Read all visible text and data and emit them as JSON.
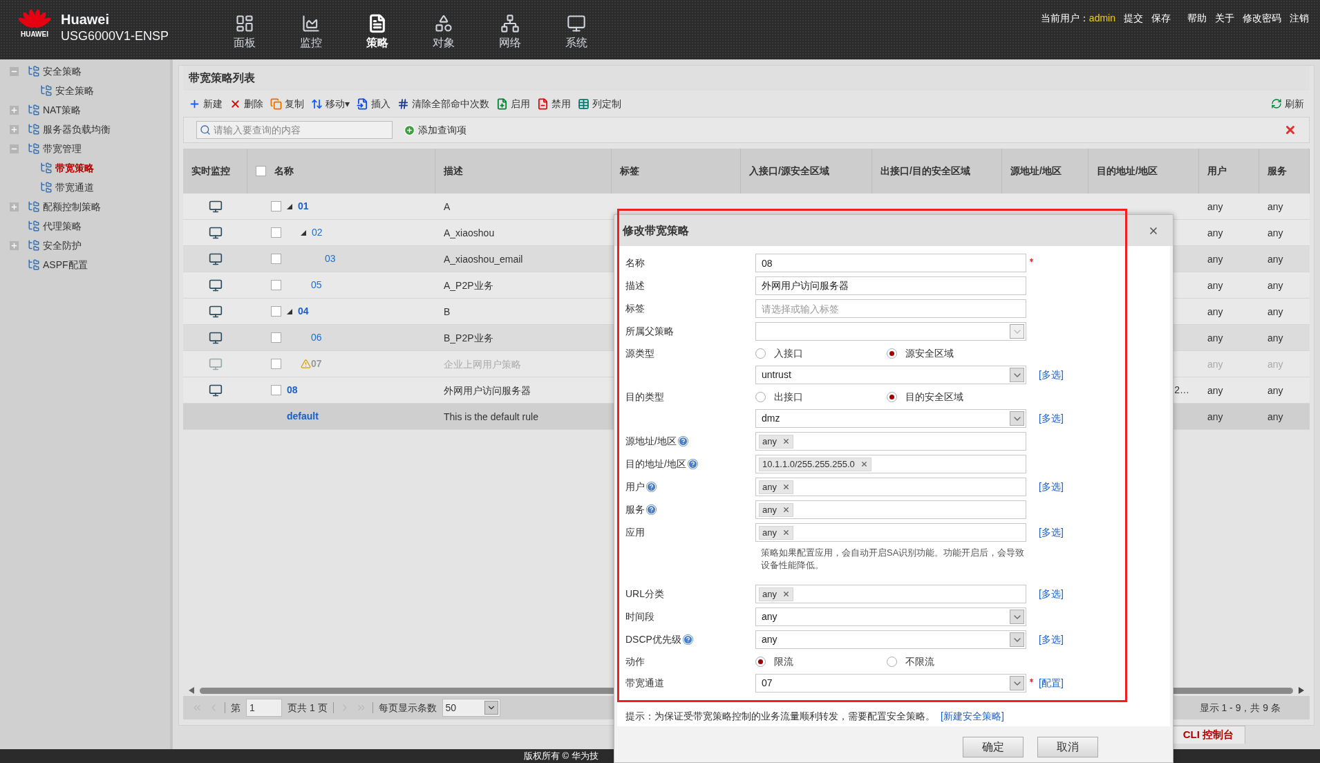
{
  "header": {
    "logo_text": "HUAWEI",
    "brand": "Huawei",
    "model": "USG6000V1-ENSP",
    "nav": [
      {
        "label": "面板",
        "selected": false
      },
      {
        "label": "监控",
        "selected": false
      },
      {
        "label": "策略",
        "selected": true
      },
      {
        "label": "对象",
        "selected": false
      },
      {
        "label": "网络",
        "selected": false
      },
      {
        "label": "系统",
        "selected": false
      }
    ],
    "user_label": "当前用户：",
    "user": "admin",
    "links": [
      "提交",
      "保存",
      "帮助",
      "关于",
      "修改密码",
      "注销"
    ]
  },
  "sidebar": {
    "items": [
      {
        "label": "安全策略",
        "expanded": true,
        "selected": false,
        "children": [
          {
            "label": "安全策略",
            "selected": false
          }
        ]
      },
      {
        "label": "NAT策略",
        "expanded": false,
        "selected": false
      },
      {
        "label": "服务器负载均衡",
        "expanded": false,
        "selected": false
      },
      {
        "label": "带宽管理",
        "expanded": true,
        "selected": false,
        "children": [
          {
            "label": "带宽策略",
            "selected": true
          },
          {
            "label": "带宽通道",
            "selected": false
          }
        ]
      },
      {
        "label": "配额控制策略",
        "expanded": false,
        "selected": false
      },
      {
        "label": "代理策略",
        "selected": false
      },
      {
        "label": "安全防护",
        "expanded": false,
        "selected": false
      },
      {
        "label": "ASPF配置",
        "selected": false
      }
    ]
  },
  "panel": {
    "title": "带宽策略列表",
    "toolbar": [
      "新建",
      "删除",
      "复制",
      "移动▾",
      "插入",
      "清除全部命中次数",
      "启用",
      "禁用",
      "列定制"
    ],
    "refresh": "刷新",
    "search": {
      "placeholder": "请输入要查询的内容"
    },
    "add_query": "添加查询项"
  },
  "table": {
    "columns": [
      "实时监控",
      "名称",
      "描述",
      "标签",
      "入接口/源安全区域",
      "出接口/目的安全区域",
      "源地址/地区",
      "目的地址/地区",
      "用户",
      "服务"
    ],
    "select_all_checked": false,
    "rows": [
      {
        "name": "01",
        "description": "A",
        "expanded": true,
        "checked": false,
        "disabled": false,
        "user": "any",
        "service": "any",
        "children": [
          {
            "name": "02",
            "description": "A_xiaoshou",
            "expanded": true,
            "checked": false,
            "disabled": false,
            "user": "any",
            "service": "any",
            "children": [
              {
                "name": "03",
                "description": "A_xiaoshou_email",
                "checked": false,
                "disabled": false,
                "user": "any",
                "service": "any"
              }
            ]
          },
          {
            "name": "05",
            "description": "A_P2P业务",
            "checked": false,
            "disabled": false,
            "user": "any",
            "service": "any"
          }
        ]
      },
      {
        "name": "04",
        "description": "B",
        "expanded": true,
        "checked": false,
        "disabled": false,
        "user": "any",
        "service": "any",
        "children": [
          {
            "name": "06",
            "description": "B_P2P业务",
            "checked": false,
            "disabled": false,
            "user": "any",
            "service": "any"
          },
          {
            "name": "07",
            "description": "企业上网用户策略",
            "checked": false,
            "disabled": true,
            "user": "any",
            "service": "any"
          }
        ]
      },
      {
        "name": "08",
        "description": "外网用户访问服务器",
        "checked": false,
        "disabled": false,
        "destination": "2…",
        "user": "any",
        "service": "any"
      },
      {
        "name": "default",
        "kind": "default",
        "description": "This is the default rule",
        "user": "any",
        "service": "any"
      }
    ]
  },
  "pager": {
    "page_label": "第",
    "page": "1",
    "total": "页共 1 页",
    "per_page_label": "每页显示条数",
    "per_page": "50",
    "summary": "显示 1 - 9，共 9 条"
  },
  "cli_tab": "CLI 控制台",
  "footer": "版权所有 © 华为技",
  "dialog": {
    "title": "修改带宽策略",
    "fields": [
      {
        "kind": "text",
        "label": "名称",
        "value": "08",
        "required": true
      },
      {
        "kind": "text",
        "label": "描述",
        "value": "外网用户访问服务器"
      },
      {
        "kind": "text",
        "label": "标签",
        "placeholder": "请选择或输入标签"
      },
      {
        "kind": "select",
        "label": "所属父策略",
        "disabled": true
      },
      {
        "kind": "radio",
        "label": "源类型",
        "options": [
          {
            "label": "入接口",
            "selected": false
          },
          {
            "label": "源安全区域",
            "selected": true
          }
        ]
      },
      {
        "kind": "select",
        "value": "untrust",
        "link": "[多选]"
      },
      {
        "kind": "radio",
        "label": "目的类型",
        "options": [
          {
            "label": "出接口",
            "selected": false
          },
          {
            "label": "目的安全区域",
            "selected": true
          }
        ]
      },
      {
        "kind": "select",
        "value": "dmz",
        "link": "[多选]"
      },
      {
        "kind": "tags",
        "label": "源地址/地区",
        "help": true,
        "tags": [
          "any"
        ]
      },
      {
        "kind": "tags",
        "label": "目的地址/地区",
        "help": true,
        "tags": [
          "10.1.1.0/255.255.255.0"
        ]
      },
      {
        "kind": "tags",
        "label": "用户",
        "help": true,
        "tags": [
          "any"
        ],
        "link": "[多选]"
      },
      {
        "kind": "tags",
        "label": "服务",
        "help": true,
        "tags": [
          "any"
        ]
      },
      {
        "kind": "tags",
        "label": "应用",
        "tags": [
          "any"
        ],
        "link": "[多选]"
      },
      {
        "kind": "note",
        "text": "策略如果配置应用，会自动开启SA识别功能。功能开启后，会导致设备性能降低。"
      },
      {
        "kind": "tags",
        "label": "URL分类",
        "tags": [
          "any"
        ],
        "link": "[多选]"
      },
      {
        "kind": "select",
        "label": "时间段",
        "value": "any"
      },
      {
        "kind": "select",
        "label": "DSCP优先级",
        "help": true,
        "value": "any",
        "link": "[多选]"
      },
      {
        "kind": "radio",
        "label": "动作",
        "options": [
          {
            "label": "限流",
            "selected": true
          },
          {
            "label": "不限流",
            "selected": false
          }
        ]
      },
      {
        "kind": "select",
        "label": "带宽通道",
        "value": "07",
        "required": true,
        "link": "[配置]"
      }
    ],
    "hint": "提示：为保证受带宽策略控制的业务流量顺利转发，需要配置安全策略。",
    "hint_link": "[新建安全策略]",
    "buttons": [
      "确定",
      "取消"
    ]
  }
}
